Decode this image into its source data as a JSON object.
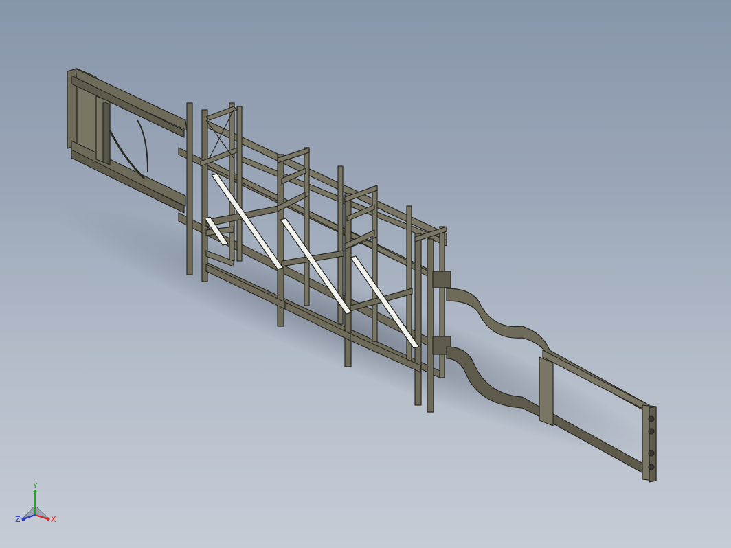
{
  "viewport": {
    "background_top": "#8795aa",
    "background_bottom": "#c6ccd6"
  },
  "model": {
    "name": "truck-chassis-with-lattice-frame",
    "steel_color": "#6f6b5a",
    "steel_edge_color": "#2a2922",
    "highlight_color": "#f2f2ee"
  },
  "triad": {
    "x_label": "X",
    "y_label": "Y",
    "z_label": "Z",
    "x_color": "#d42a2a",
    "y_color": "#2aa12a",
    "z_color": "#2a3ad4"
  }
}
